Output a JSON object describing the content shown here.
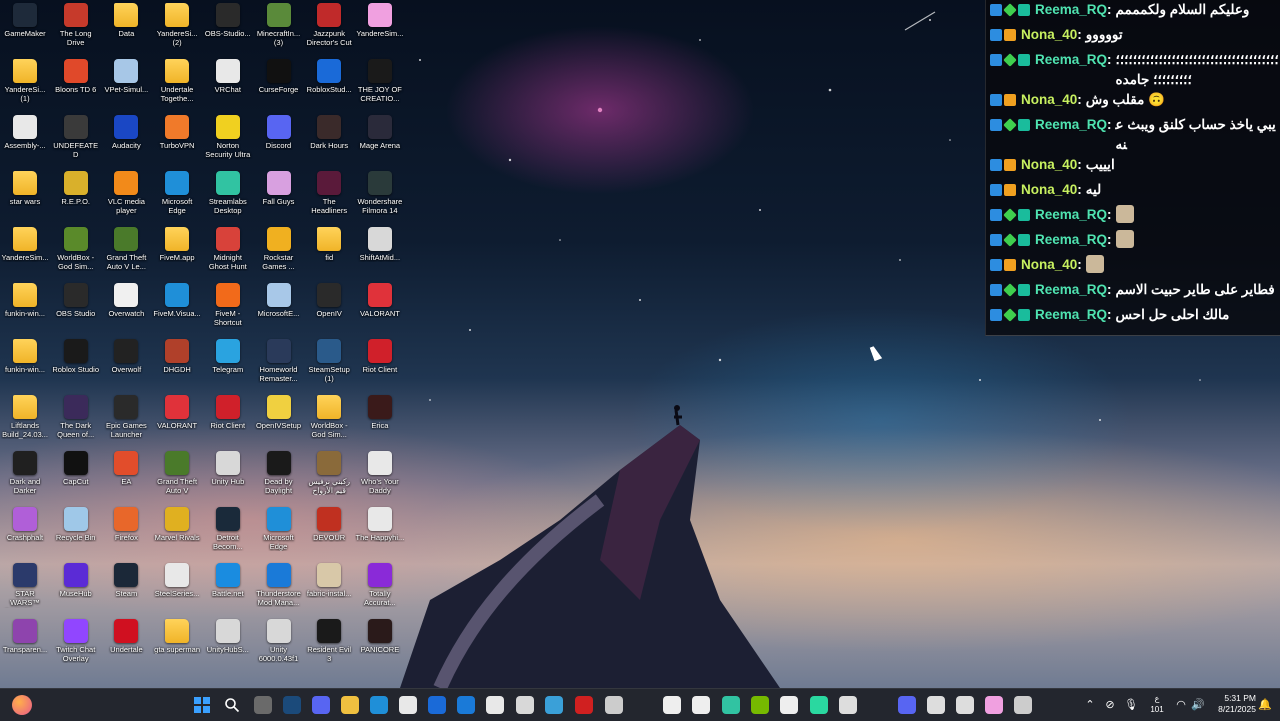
{
  "desktop": {
    "icons": [
      {
        "label": "GameMaker",
        "icon": "gamemaker-icon",
        "color": "#1e2a3a"
      },
      {
        "label": "YandereSi... (1)",
        "icon": "folder-icon",
        "color": "folder"
      },
      {
        "label": "Assembly-...",
        "icon": "file-icon",
        "color": "#e8e8e8"
      },
      {
        "label": "star wars",
        "icon": "folder-icon",
        "color": "folder"
      },
      {
        "label": "YandereSim...",
        "icon": "folder-icon",
        "color": "folder"
      },
      {
        "label": "funkin-win...",
        "icon": "folder-icon",
        "color": "folder"
      },
      {
        "label": "funkin-win...",
        "icon": "folder-icon",
        "color": "folder"
      },
      {
        "label": "Liftlands Build_24.03...",
        "icon": "folder-icon",
        "color": "folder"
      },
      {
        "label": "Dark and Darker",
        "icon": "dark-and-darker-icon",
        "color": "#202020"
      },
      {
        "label": "Crashphalt",
        "icon": "crashphalt-icon",
        "color": "#b05fd8"
      },
      {
        "label": "STAR WARS™ Battlefront...",
        "icon": "star-wars-icon",
        "color": "#2b3a6b"
      },
      {
        "label": "Transparen...",
        "icon": "transparent-icon",
        "color": "#8e44ad"
      },
      {
        "label": "The Long Drive",
        "icon": "the-long-drive-icon",
        "color": "#c63a2b"
      },
      {
        "label": "Bloons TD 6",
        "icon": "bloons-icon",
        "color": "#e0492a"
      },
      {
        "label": "UNDEFEATED",
        "icon": "undefeated-icon",
        "color": "#3a3a3a"
      },
      {
        "label": "R.E.P.O.",
        "icon": "repo-icon",
        "color": "#d9b02b"
      },
      {
        "label": "WorldBox - God Sim...",
        "icon": "worldbox-icon",
        "color": "#5a8a2a"
      },
      {
        "label": "OBS Studio",
        "icon": "obs-icon",
        "color": "#2a2a2a"
      },
      {
        "label": "Roblox Studio",
        "icon": "roblox-studio-icon",
        "color": "#1a1a1a"
      },
      {
        "label": "The Dark Queen of...",
        "icon": "dark-queen-icon",
        "color": "#3b2a5a"
      },
      {
        "label": "CapCut",
        "icon": "capcut-icon",
        "color": "#111111"
      },
      {
        "label": "Recycle Bin",
        "icon": "recycle-bin-icon",
        "color": "#9fc8e8"
      },
      {
        "label": "MuseHub",
        "icon": "musehub-icon",
        "color": "#5b2bd6"
      },
      {
        "label": "Twitch Chat Overlay",
        "icon": "twitch-icon",
        "color": "#9146ff"
      },
      {
        "label": "Data",
        "icon": "folder-icon",
        "color": "folder"
      },
      {
        "label": "VPet-Simul...",
        "icon": "vpet-icon",
        "color": "#a7c7e7"
      },
      {
        "label": "Audacity",
        "icon": "audacity-icon",
        "color": "#1a47c4"
      },
      {
        "label": "VLC media player",
        "icon": "vlc-icon",
        "color": "#f28a1a"
      },
      {
        "label": "Grand Theft Auto V Le...",
        "icon": "gta-icon",
        "color": "#4a7a2a"
      },
      {
        "label": "Overwatch",
        "icon": "overwatch-icon",
        "color": "#f0f0f0"
      },
      {
        "label": "Overwolf",
        "icon": "overwolf-icon",
        "color": "#222222"
      },
      {
        "label": "Epic Games Launcher",
        "icon": "epic-games-icon",
        "color": "#2a2a2a"
      },
      {
        "label": "EA",
        "icon": "ea-icon",
        "color": "#e24d2b"
      },
      {
        "label": "Firefox",
        "icon": "firefox-icon",
        "color": "#e8672a"
      },
      {
        "label": "Steam",
        "icon": "steam-icon",
        "color": "#1b2838"
      },
      {
        "label": "Undertale",
        "icon": "undertale-icon",
        "color": "#d01020"
      },
      {
        "label": "YandereSi... (2)",
        "icon": "folder-icon",
        "color": "folder"
      },
      {
        "label": "Undertale Togethe...",
        "icon": "folder-icon",
        "color": "folder"
      },
      {
        "label": "TurboVPN",
        "icon": "turbovpn-icon",
        "color": "#f07a2a"
      },
      {
        "label": "Microsoft Edge",
        "icon": "edge-icon",
        "color": "#1f8fd8"
      },
      {
        "label": "FiveM.app",
        "icon": "folder-icon",
        "color": "folder"
      },
      {
        "label": "FiveM.Visua...",
        "icon": "edge-icon",
        "color": "#1f8fd8"
      },
      {
        "label": "DHGDH",
        "icon": "dhgdh-icon",
        "color": "#b0402a"
      },
      {
        "label": "VALORANT",
        "icon": "valorant-icon",
        "color": "#e0323a"
      },
      {
        "label": "Grand Theft Auto V",
        "icon": "gta-icon",
        "color": "#4a7a2a"
      },
      {
        "label": "Marvel Rivals",
        "icon": "marvel-rivals-icon",
        "color": "#e0b020"
      },
      {
        "label": "SteelSeries...",
        "icon": "steelseries-icon",
        "color": "#e8e8e8"
      },
      {
        "label": "gta superman",
        "icon": "folder-icon",
        "color": "folder"
      },
      {
        "label": "OBS-Studio...",
        "icon": "obs-icon",
        "color": "#2a2a2a"
      },
      {
        "label": "VRChat",
        "icon": "file-icon",
        "color": "#e8e8e8"
      },
      {
        "label": "Norton Security Ultra",
        "icon": "norton-icon",
        "color": "#f0d020"
      },
      {
        "label": "Streamlabs Desktop",
        "icon": "streamlabs-icon",
        "color": "#31c3a2"
      },
      {
        "label": "Midnight Ghost Hunt",
        "icon": "midnight-ghost-hunt-icon",
        "color": "#d8423a"
      },
      {
        "label": "FiveM - Shortcut",
        "icon": "fivem-icon",
        "color": "#f26a1a"
      },
      {
        "label": "Telegram",
        "icon": "telegram-icon",
        "color": "#2aa3e0"
      },
      {
        "label": "Riot Client",
        "icon": "riot-client-icon",
        "color": "#d0202a"
      },
      {
        "label": "Unity Hub",
        "icon": "unity-hub-icon",
        "color": "#d8d8d8"
      },
      {
        "label": "Detroit Becom...",
        "icon": "detroit-icon",
        "color": "#1a2a3a"
      },
      {
        "label": "Battle.net",
        "icon": "battlenet-icon",
        "color": "#1a8ce0"
      },
      {
        "label": "UnityHubS...",
        "icon": "unity-hub-icon",
        "color": "#d8d8d8"
      },
      {
        "label": "MinecraftIn... (3)",
        "icon": "minecraft-icon",
        "color": "#5a8a3a"
      },
      {
        "label": "CurseForge",
        "icon": "curseforge-icon",
        "color": "#111111"
      },
      {
        "label": "Discord",
        "icon": "discord-icon",
        "color": "#5865f2"
      },
      {
        "label": "Fall Guys",
        "icon": "fall-guys-icon",
        "color": "#d8a0e0"
      },
      {
        "label": "Rockstar Games ...",
        "icon": "rockstar-icon",
        "color": "#f0b020"
      },
      {
        "label": "MicrosoftE...",
        "icon": "microsoft-edge-setup-icon",
        "color": "#a8c8e8"
      },
      {
        "label": "Homeworld Remaster...",
        "icon": "homeworld-icon",
        "color": "#2a3a5a"
      },
      {
        "label": "OpenIVSetup",
        "icon": "openiv-setup-icon",
        "color": "#f0d040"
      },
      {
        "label": "Dead by Daylight",
        "icon": "dbd-icon",
        "color": "#1a1a1a"
      },
      {
        "label": "Microsoft Edge",
        "icon": "edge-icon",
        "color": "#1f8fd8"
      },
      {
        "label": "Thunderstore Mod Mana...",
        "icon": "thunderstore-icon",
        "color": "#1a7ad8"
      },
      {
        "label": "Unity 6000.0.43f1",
        "icon": "unity-icon",
        "color": "#d8d8d8"
      },
      {
        "label": "Jazzpunk Director's Cut",
        "icon": "jazzpunk-icon",
        "color": "#c02a2a"
      },
      {
        "label": "RobloxStud...",
        "icon": "roblox-studio-icon",
        "color": "#1a6ad8"
      },
      {
        "label": "Dark Hours",
        "icon": "dark-hours-icon",
        "color": "#3a2a2a"
      },
      {
        "label": "The Headliners",
        "icon": "headliners-icon",
        "color": "#5a1a3a"
      },
      {
        "label": "fid",
        "icon": "folder-icon",
        "color": "folder"
      },
      {
        "label": "OpenIV",
        "icon": "openiv-icon",
        "color": "#2a2a2a"
      },
      {
        "label": "SteamSetup (1)",
        "icon": "steam-setup-icon",
        "color": "#2a5a8a"
      },
      {
        "label": "WorldBox - God Sim...",
        "icon": "folder-icon",
        "color": "folder"
      },
      {
        "label": "ركبني نرفيس قيم الأرواح",
        "icon": "game-icon",
        "color": "#8a6a3a"
      },
      {
        "label": "DEVOUR",
        "icon": "devour-icon",
        "color": "#c03020"
      },
      {
        "label": "fabric-instal...",
        "icon": "fabric-icon",
        "color": "#d8c8a8"
      },
      {
        "label": "Resident Evil 3",
        "icon": "resident-evil-icon",
        "color": "#1a1a1a"
      },
      {
        "label": "YandereSim...",
        "icon": "yandere-sim-icon",
        "color": "#f0a0e0"
      },
      {
        "label": "THE JOY OF CREATIO...",
        "icon": "joy-of-creation-icon",
        "color": "#1a1a1a"
      },
      {
        "label": "Mage Arena",
        "icon": "mage-arena-icon",
        "color": "#2a2a3a"
      },
      {
        "label": "Wondershare Filmora 14",
        "icon": "filmora-icon",
        "color": "#2a3a3a"
      },
      {
        "label": "ShiftAtMid...",
        "icon": "shift-at-midnight-icon",
        "color": "#d8d8d8"
      },
      {
        "label": "VALORANT",
        "icon": "valorant-icon",
        "color": "#e0323a"
      },
      {
        "label": "Riot Client",
        "icon": "riot-client-icon",
        "color": "#d0202a"
      },
      {
        "label": "Erica",
        "icon": "erica-icon",
        "color": "#3a1a1a"
      },
      {
        "label": "Who's Your Daddy",
        "icon": "whos-your-daddy-icon",
        "color": "#e8e8e8"
      },
      {
        "label": "The Happyhi...",
        "icon": "happyhills-icon",
        "color": "#e8e8e8"
      },
      {
        "label": "Totally Accurat...",
        "icon": "tabs-icon",
        "color": "#8a2ad8"
      },
      {
        "label": "PANICORE",
        "icon": "panicore-icon",
        "color": "#2a1a1a"
      }
    ]
  },
  "chat": {
    "messages": [
      {
        "user": "Reema_RQ",
        "text": "وعليكم السلام ولكمممم",
        "badges": [
          "mod",
          "star",
          "sub"
        ]
      },
      {
        "user": "Nona_40",
        "text": "تووووو",
        "badges": [
          "mod",
          "crown"
        ]
      },
      {
        "user": "Reema_RQ",
        "text": "؛؛؛؛؛؛؛؛؛؛؛؛؛؛؛؛؛؛؛؛؛؛؛؛؛؛؛؛؛؛؛؛؛؛؛؛؛؛ ؛؛؛؛؛؛؛؛؛ جامده",
        "badges": [
          "mod",
          "star",
          "sub"
        ]
      },
      {
        "user": "Nona_40",
        "text": "مقلب وش 🙃",
        "badges": [
          "mod",
          "crown"
        ]
      },
      {
        "user": "Reema_RQ",
        "text": "يبي ياخذ حساب كلنق ويبث عنه",
        "badges": [
          "mod",
          "star",
          "sub"
        ]
      },
      {
        "user": "Nona_40",
        "text": "ايييب",
        "badges": [
          "mod",
          "crown"
        ]
      },
      {
        "user": "Nona_40",
        "text": "ليه",
        "badges": [
          "mod",
          "crown"
        ]
      },
      {
        "user": "Reema_RQ",
        "text": "",
        "emote": true,
        "badges": [
          "mod",
          "star",
          "sub"
        ]
      },
      {
        "user": "Reema_RQ",
        "text": "",
        "emote": true,
        "badges": [
          "mod",
          "star",
          "sub"
        ]
      },
      {
        "user": "Nona_40",
        "text": "",
        "emote": true,
        "badges": [
          "mod",
          "crown"
        ]
      },
      {
        "user": "Reema_RQ",
        "text": "فطاير على طاير حبيت الاسم",
        "badges": [
          "mod",
          "star",
          "sub"
        ]
      },
      {
        "user": "Reema_RQ",
        "text": "مالك احلى حل احس",
        "badges": [
          "mod",
          "star",
          "sub"
        ]
      }
    ]
  },
  "taskbar": {
    "pinned": [
      {
        "icon": "file-explorer-icon",
        "color": "#6a6a6a"
      },
      {
        "icon": "steam-icon",
        "color": "#1b4a7a"
      },
      {
        "icon": "discord-icon",
        "color": "#5865f2"
      },
      {
        "icon": "folder-icon",
        "color": "#f0c040"
      },
      {
        "icon": "edge-icon",
        "color": "#1f8fd8"
      },
      {
        "icon": "store-icon",
        "color": "#e8e8e8"
      },
      {
        "icon": "app-icon",
        "color": "#1a6ad8"
      },
      {
        "icon": "thunderstore-icon",
        "color": "#1a7ad8"
      },
      {
        "icon": "capcut-icon",
        "color": "#e8e8e8"
      },
      {
        "icon": "notepad-icon",
        "color": "#d8d8d8"
      },
      {
        "icon": "paint-icon",
        "color": "#3aa0d8"
      },
      {
        "icon": "valorant-icon",
        "color": "#d02020"
      },
      {
        "icon": "unity-hub-icon",
        "color": "#cccccc"
      },
      {
        "icon": "curseforge-icon",
        "color": "#eeeeee"
      },
      {
        "icon": "game-icon",
        "color": "#eeeeee"
      },
      {
        "icon": "streamlabs-icon",
        "color": "#31c3a2"
      },
      {
        "icon": "nvidia-icon",
        "color": "#76b900"
      },
      {
        "icon": "app-icon",
        "color": "#eeeeee"
      },
      {
        "icon": "app-icon",
        "color": "#2ad8a0"
      },
      {
        "icon": "shield-icon",
        "color": "#dddddd"
      },
      {
        "icon": "discord-icon",
        "color": "#5865f2"
      },
      {
        "icon": "obs-icon",
        "color": "#dddddd"
      },
      {
        "icon": "settings-icon",
        "color": "#dddddd"
      },
      {
        "icon": "yandere-sim-icon",
        "color": "#f0a0e0"
      },
      {
        "icon": "unreal-icon",
        "color": "#cccccc"
      }
    ],
    "language": "ع",
    "language_sub": "101",
    "time": "5:31 PM",
    "date": "8/21/2025"
  }
}
